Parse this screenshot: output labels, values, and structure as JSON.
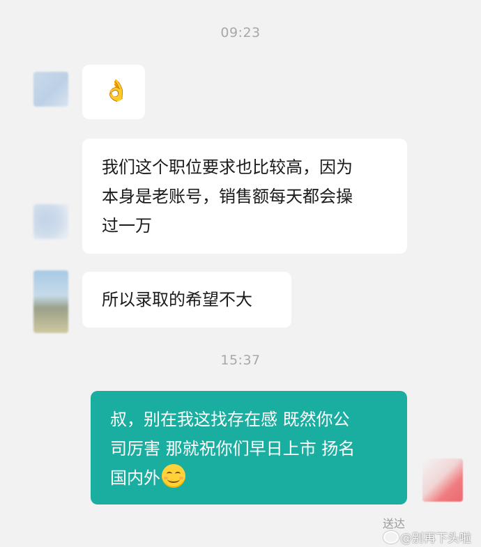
{
  "timestamps": [
    "09:23",
    "15:37"
  ],
  "messages": [
    {
      "sender": "other",
      "text": "👌"
    },
    {
      "sender": "other",
      "lines": [
        "我们这个职位要求也比较高，因为",
        "本身是老账号，销售额每天都会操",
        "过一万"
      ]
    },
    {
      "sender": "other",
      "text": "所以录取的希望不大"
    },
    {
      "sender": "me",
      "lines": [
        "叔，别在我这找存在感 既然你公",
        "司厉害 那就祝你们早日上市 扬名",
        "国内外"
      ],
      "trailing_emoji": "smiling-face-emoji"
    }
  ],
  "status": "送达",
  "watermark": "@别再下头啦",
  "colors": {
    "background": "#f2f2f2",
    "my_bubble": "#1aaea0",
    "other_bubble": "#ffffff"
  }
}
